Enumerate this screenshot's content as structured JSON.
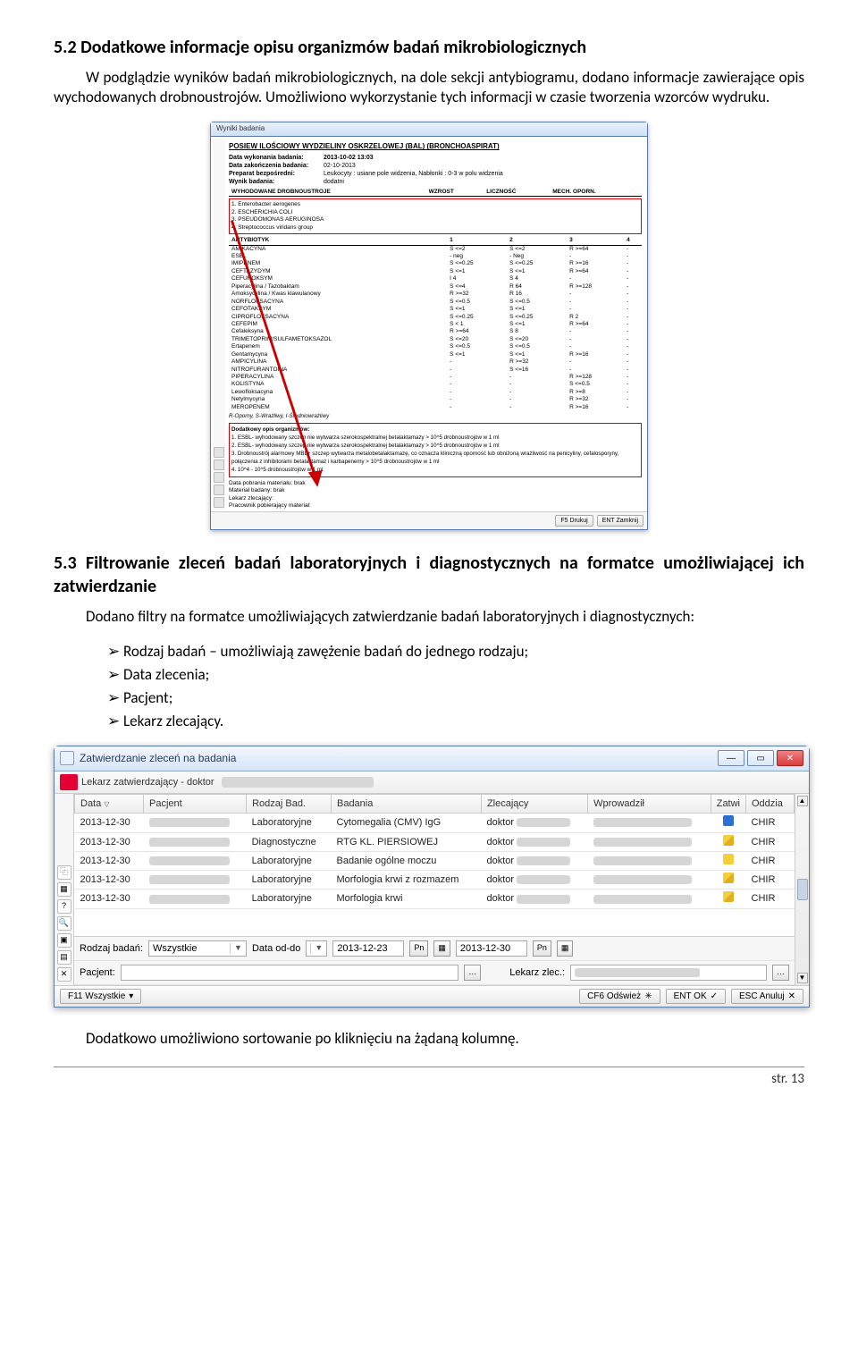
{
  "section52": {
    "heading": "5.2 Dodatkowe informacje opisu organizmów badań mikrobiologicznych",
    "para": "W podglądzie wyników badań mikrobiologicznych, na dole sekcji antybiogramu, dodano informacje zawierające opis wychodowanych drobnoustrojów. Umożliwiono wykorzystanie tych informacji w czasie tworzenia wzorców wydruku."
  },
  "win1": {
    "title": "Wyniki badania",
    "heading": "POSIEW ILOŚCIOWY WYDZIELINY OSKRZELOWEJ (BAL) (BRONCHOASPIRAT)",
    "data_wyk_lbl": "Data wykonania badania:",
    "data_wyk": "2013-10-02 13:03",
    "data_zak_lbl": "Data zakończenia badania:",
    "data_zak": "02-10-2013",
    "preparat_lbl": "Preparat bezpośredni:",
    "preparat": "Leukocyty : usiane pole widzenia, Nabłonki : 0-3 w polu widzenia",
    "wynik_lbl": "Wynik badania:",
    "wynik": "dodatni",
    "org_header": "WYHODOWANE DROBNOUSTROJE",
    "cols": [
      "WZROST",
      "LICZNOŚĆ",
      "MECH. OPORN."
    ],
    "orgs": [
      "1. Enterobacter aerogenes",
      "2. ESCHERICHIA COLI",
      "3. PSEUDOMONAS AERUGINOSA",
      "4. Streptococcus viridans group"
    ],
    "anty_lbl": "ANTYBIOTYK",
    "anty_cols": [
      "1",
      "2",
      "3",
      "4"
    ],
    "antibiotics": [
      {
        "n": "AMIKACYNA",
        "v": [
          "S <=2",
          "S <=2",
          "R >=64",
          "-"
        ]
      },
      {
        "n": "ESBL",
        "v": [
          "- neg",
          "- Neg",
          "-",
          "-"
        ]
      },
      {
        "n": "IMIPENEM",
        "v": [
          "S <=0.25",
          "S <=0.25",
          "R >=16",
          "-"
        ]
      },
      {
        "n": "CEFTAZYDYM",
        "v": [
          "S <=1",
          "S <=1",
          "R >=64",
          "-"
        ]
      },
      {
        "n": "CEFUROKSYM",
        "v": [
          "I 4",
          "S 4",
          "-",
          "-"
        ]
      },
      {
        "n": "Piperacylina / Tazobaktam",
        "v": [
          "S <=4",
          "R 64",
          "R >=128",
          "-"
        ]
      },
      {
        "n": "Amoksycylina / Kwas klawulanowy",
        "v": [
          "R >=32",
          "R 16",
          "-",
          "-"
        ]
      },
      {
        "n": "NORFLOKSACYNA",
        "v": [
          "S <=0.5",
          "S <=0.5",
          "-",
          "-"
        ]
      },
      {
        "n": "CEFOTAKSYM",
        "v": [
          "S <=1",
          "S <=1",
          "-",
          "-"
        ]
      },
      {
        "n": "CIPROFLOKSACYNA",
        "v": [
          "S <=0.25",
          "S <=0.25",
          "R 2",
          "-"
        ]
      },
      {
        "n": "CEFEPIM",
        "v": [
          "S < 1",
          "S <=1",
          "R >=64",
          "-"
        ]
      },
      {
        "n": "Cefaleksyna",
        "v": [
          "R >=64",
          "S 8",
          "-",
          "-"
        ]
      },
      {
        "n": "TRIMETOPRIM/SULFAMETOKSAZOL",
        "v": [
          "S <=20",
          "S <=20",
          "-",
          "-"
        ]
      },
      {
        "n": "Ertapenem",
        "v": [
          "S <=0.5",
          "S <=0.5",
          "-",
          "-"
        ]
      },
      {
        "n": "Gentamycyna",
        "v": [
          "S <=1",
          "S <=1",
          "R >=16",
          "-"
        ]
      },
      {
        "n": "AMPICYLINA",
        "v": [
          "-",
          "R >=32",
          "-",
          "-"
        ]
      },
      {
        "n": "NITROFURANTOINA",
        "v": [
          "-",
          "S <=16",
          "-",
          "-"
        ]
      },
      {
        "n": "PIPERACYLINA",
        "v": [
          "-",
          "-",
          "R >=128",
          "-"
        ]
      },
      {
        "n": "KOLISTYNA",
        "v": [
          "-",
          "-",
          "S <=0.5",
          "-"
        ]
      },
      {
        "n": "Lewofloksacyna",
        "v": [
          "-",
          "-",
          "R >=8",
          "-"
        ]
      },
      {
        "n": "Netylmycyna",
        "v": [
          "-",
          "-",
          "R >=32",
          "-"
        ]
      },
      {
        "n": "MEROPENEM",
        "v": [
          "-",
          "-",
          "R >=16",
          "-"
        ]
      }
    ],
    "legend": "R-Oporny, S-Wrażliwy, I-Średniowrażliwy",
    "extra_title": "Dodatkowy opis organizmów:",
    "extra": [
      "1. ESBL- wyhodowany szczep nie wytwarza szerokospektralnej betalaktamazy > 10^5 drobnoustrojów w 1 ml",
      "2. ESBL- wyhodowany szczep nie wytwarza szerokospektralnej betalaktamazy > 10^5 drobnoustrojów w 1 ml",
      "3. Drobnoustrój alarmowy MBL+ szczep wytwarza metalobetalaktamazę, co oznacza kliniczną oporność lub obniżoną wrażliwość na penicyliny, cefalosporyny, połączenia z inhibitorami betalaktamaz i karbapenemy > 10^5 drobnoustrojów w 1 ml",
      "4. 10^4 - 10^5 drobnoustrojów w 1 ml"
    ],
    "extra_tail": [
      "Data pobrania materiału: brak",
      "Materiał badany: brak",
      "Lekarz zlecający:",
      "Pracownik pobierający materiał:"
    ],
    "btn_print": "F5 Drukuj",
    "btn_close": "ENT Zamknij"
  },
  "section53": {
    "heading_num": "5.3",
    "heading_rest": "Filtrowanie zleceń badań laboratoryjnych i diagnostycznych na formatce umożliwiającej ich zatwierdzanie",
    "para": "Dodano filtry na formatce umożliwiających zatwierdzanie badań laboratoryjnych i diagnostycznych:",
    "bullets": [
      "Rodzaj badań – umożliwiają zawężenie badań do jednego rodzaju;",
      "Data zlecenia;",
      "Pacjent;",
      "Lekarz zlecający."
    ]
  },
  "win2": {
    "title": "Zatwierdzanie zleceń na badania",
    "toolbar_lbl": "Lekarz zatwierdzający - doktor",
    "columns": [
      "Data",
      "Pacjent",
      "Rodzaj Bad.",
      "Badania",
      "Zlecający",
      "Wprowadził",
      "Zatwi",
      "Oddzia"
    ],
    "rows": [
      {
        "date": "2013-12-30",
        "type": "Laboratoryjne",
        "exam": "Cytomegalia (CMV) IgG",
        "zlec": "doktor",
        "ward": "CHIR",
        "icn": "blue"
      },
      {
        "date": "2013-12-30",
        "type": "Diagnostyczne",
        "exam": "RTG KL. PIERSIOWEJ",
        "zlec": "doktor",
        "ward": "CHIR",
        "icn": "pencil"
      },
      {
        "date": "2013-12-30",
        "type": "Laboratoryjne",
        "exam": "Badanie ogólne moczu",
        "zlec": "doktor",
        "ward": "CHIR",
        "icn": "yellow"
      },
      {
        "date": "2013-12-30",
        "type": "Laboratoryjne",
        "exam": "Morfologia krwi z rozmazem",
        "zlec": "doktor",
        "ward": "CHIR",
        "icn": "pencil"
      },
      {
        "date": "2013-12-30",
        "type": "Laboratoryjne",
        "exam": "Morfologia krwi",
        "zlec": "doktor",
        "ward": "CHIR",
        "icn": "pencil"
      }
    ],
    "filters": {
      "rodzaj_lbl": "Rodzaj badań:",
      "rodzaj_val": "Wszystkie",
      "data_lbl": "Data od-do",
      "date_from": "2013-12-23",
      "date_to": "2013-12-30",
      "pn": "Pn",
      "cal": "▦",
      "pacjent_lbl": "Pacjent:",
      "lekarz_lbl": "Lekarz zlec.:"
    },
    "statusbar": {
      "left": "F11 Wszystkie",
      "refresh": "CF6 Odśwież",
      "ok": "ENT OK",
      "cancel": "ESC Anuluj"
    }
  },
  "closing": "Dodatkowo umożliwiono sortowanie po kliknięciu na żądaną kolumnę.",
  "page_footer": "str. 13"
}
